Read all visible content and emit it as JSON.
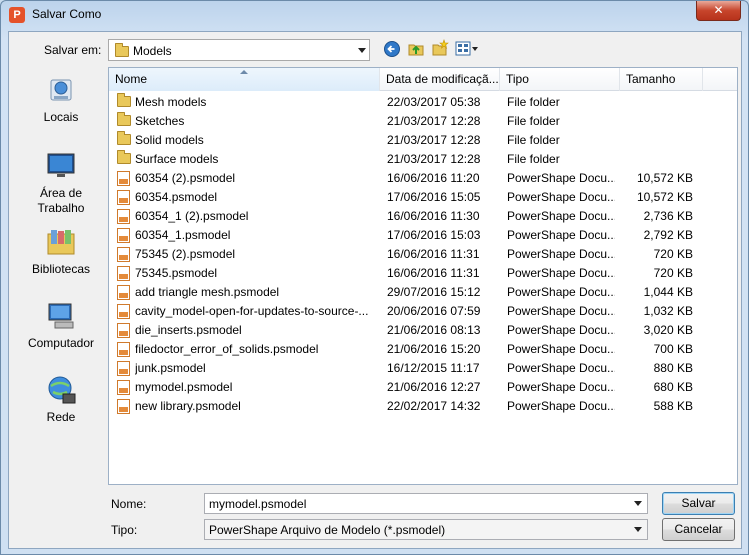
{
  "window": {
    "title": "Salvar Como",
    "close_glyph": "✕",
    "app_icon_letter": "P"
  },
  "location": {
    "label": "Salvar em:",
    "current": "Models"
  },
  "places": [
    {
      "name": "Locais",
      "icon": "recent-places-icon"
    },
    {
      "name": "Área de Trabalho",
      "icon": "desktop-icon"
    },
    {
      "name": "Bibliotecas",
      "icon": "libraries-icon"
    },
    {
      "name": "Computador",
      "icon": "computer-icon"
    },
    {
      "name": "Rede",
      "icon": "network-icon"
    }
  ],
  "columns": {
    "name": "Nome",
    "date": "Data de modificaçã...",
    "type": "Tipo",
    "size": "Tamanho"
  },
  "files": [
    {
      "name": "Mesh models",
      "date": "22/03/2017 05:38",
      "type": "File folder",
      "size": "",
      "kind": "folder"
    },
    {
      "name": "Sketches",
      "date": "21/03/2017 12:28",
      "type": "File folder",
      "size": "",
      "kind": "folder"
    },
    {
      "name": "Solid models",
      "date": "21/03/2017 12:28",
      "type": "File folder",
      "size": "",
      "kind": "folder"
    },
    {
      "name": "Surface models",
      "date": "21/03/2017 12:28",
      "type": "File folder",
      "size": "",
      "kind": "folder"
    },
    {
      "name": "60354 (2).psmodel",
      "date": "16/06/2016 11:20",
      "type": "PowerShape Docu...",
      "size": "10,572 KB",
      "kind": "file"
    },
    {
      "name": "60354.psmodel",
      "date": "17/06/2016 15:05",
      "type": "PowerShape Docu...",
      "size": "10,572 KB",
      "kind": "file"
    },
    {
      "name": "60354_1 (2).psmodel",
      "date": "16/06/2016 11:30",
      "type": "PowerShape Docu...",
      "size": "2,736 KB",
      "kind": "file"
    },
    {
      "name": "60354_1.psmodel",
      "date": "17/06/2016 15:03",
      "type": "PowerShape Docu...",
      "size": "2,792 KB",
      "kind": "file"
    },
    {
      "name": "75345 (2).psmodel",
      "date": "16/06/2016 11:31",
      "type": "PowerShape Docu...",
      "size": "720 KB",
      "kind": "file"
    },
    {
      "name": "75345.psmodel",
      "date": "16/06/2016 11:31",
      "type": "PowerShape Docu...",
      "size": "720 KB",
      "kind": "file"
    },
    {
      "name": "add triangle mesh.psmodel",
      "date": "29/07/2016 15:12",
      "type": "PowerShape Docu...",
      "size": "1,044 KB",
      "kind": "file"
    },
    {
      "name": "cavity_model-open-for-updates-to-source-...",
      "date": "20/06/2016 07:59",
      "type": "PowerShape Docu...",
      "size": "1,032 KB",
      "kind": "file"
    },
    {
      "name": "die_inserts.psmodel",
      "date": "21/06/2016 08:13",
      "type": "PowerShape Docu...",
      "size": "3,020 KB",
      "kind": "file"
    },
    {
      "name": "filedoctor_error_of_solids.psmodel",
      "date": "21/06/2016 15:20",
      "type": "PowerShape Docu...",
      "size": "700 KB",
      "kind": "file"
    },
    {
      "name": "junk.psmodel",
      "date": "16/12/2015 11:17",
      "type": "PowerShape Docu...",
      "size": "880 KB",
      "kind": "file"
    },
    {
      "name": "mymodel.psmodel",
      "date": "21/06/2016 12:27",
      "type": "PowerShape Docu...",
      "size": "680 KB",
      "kind": "file"
    },
    {
      "name": "new library.psmodel",
      "date": "22/02/2017 14:32",
      "type": "PowerShape Docu...",
      "size": "588 KB",
      "kind": "file"
    }
  ],
  "filename": {
    "label": "Nome:",
    "value": "mymodel.psmodel"
  },
  "filetype": {
    "label": "Tipo:",
    "value": "PowerShape Arquivo de Modelo (*.psmodel)"
  },
  "buttons": {
    "save": "Salvar",
    "cancel": "Cancelar"
  }
}
